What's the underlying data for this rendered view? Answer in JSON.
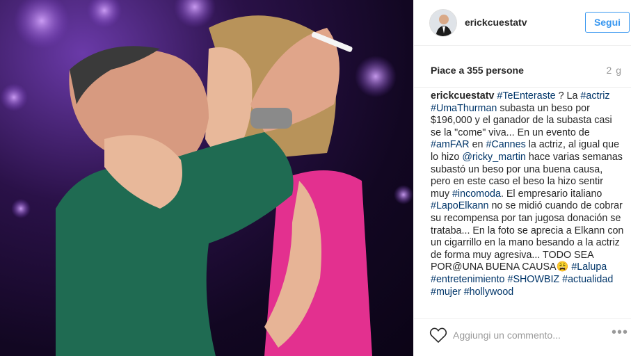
{
  "post": {
    "photo_alt_icon": "photo-icon",
    "author": {
      "username": "erickcuestatv",
      "follow_label": "Segui"
    },
    "likes_text": "Piace a 355 persone",
    "time_ago": "2 g",
    "caption": {
      "author": "erickcuestatv",
      "segments": [
        {
          "text": "#TeEnteraste",
          "tag": true
        },
        {
          "text": " ? La ",
          "tag": false
        },
        {
          "text": "#actriz",
          "tag": true
        },
        {
          "text": " ",
          "tag": false
        },
        {
          "text": "#UmaThurman",
          "tag": true
        },
        {
          "text": " subasta un beso por $196,000 y el ganador de la subasta casi se la \"come\" viva... En un evento de ",
          "tag": false
        },
        {
          "text": "#amFAR",
          "tag": true
        },
        {
          "text": " en ",
          "tag": false
        },
        {
          "text": "#Cannes",
          "tag": true
        },
        {
          "text": " la actriz, al igual que lo hizo ",
          "tag": false
        },
        {
          "text": "@ricky_martin",
          "tag": true
        },
        {
          "text": " hace varias semanas subastó un beso por una buena causa, pero en este caso el beso la hizo sentir muy ",
          "tag": false
        },
        {
          "text": "#incomoda",
          "tag": true
        },
        {
          "text": ". El empresario italiano ",
          "tag": false
        },
        {
          "text": "#LapoElkann",
          "tag": true
        },
        {
          "text": " no se midió cuando de cobrar su recompensa por tan jugosa donación se trataba... En la foto se aprecia a Elkann con un cigarrillo en la mano besando a la actriz de forma muy agresiva... TODO SEA POR@UNA BUENA CAUSA😩 ",
          "tag": false
        },
        {
          "text": "#Lalupa",
          "tag": true
        },
        {
          "text": " ",
          "tag": false
        },
        {
          "text": "#entretenimiento",
          "tag": true
        },
        {
          "text": " ",
          "tag": false
        },
        {
          "text": "#SHOWBIZ",
          "tag": true
        },
        {
          "text": " ",
          "tag": false
        },
        {
          "text": "#actualidad",
          "tag": true
        },
        {
          "text": " ",
          "tag": false
        },
        {
          "text": "#mujer",
          "tag": true
        },
        {
          "text": " ",
          "tag": false
        },
        {
          "text": "#hollywood",
          "tag": true
        }
      ]
    },
    "comment": {
      "placeholder": "Aggiungi un commento..."
    },
    "icons": {
      "like": "heart-icon",
      "more": "more-options-icon"
    },
    "colors": {
      "link": "#003569",
      "accent": "#3897f0",
      "muted": "#999999",
      "text": "#262626"
    }
  }
}
